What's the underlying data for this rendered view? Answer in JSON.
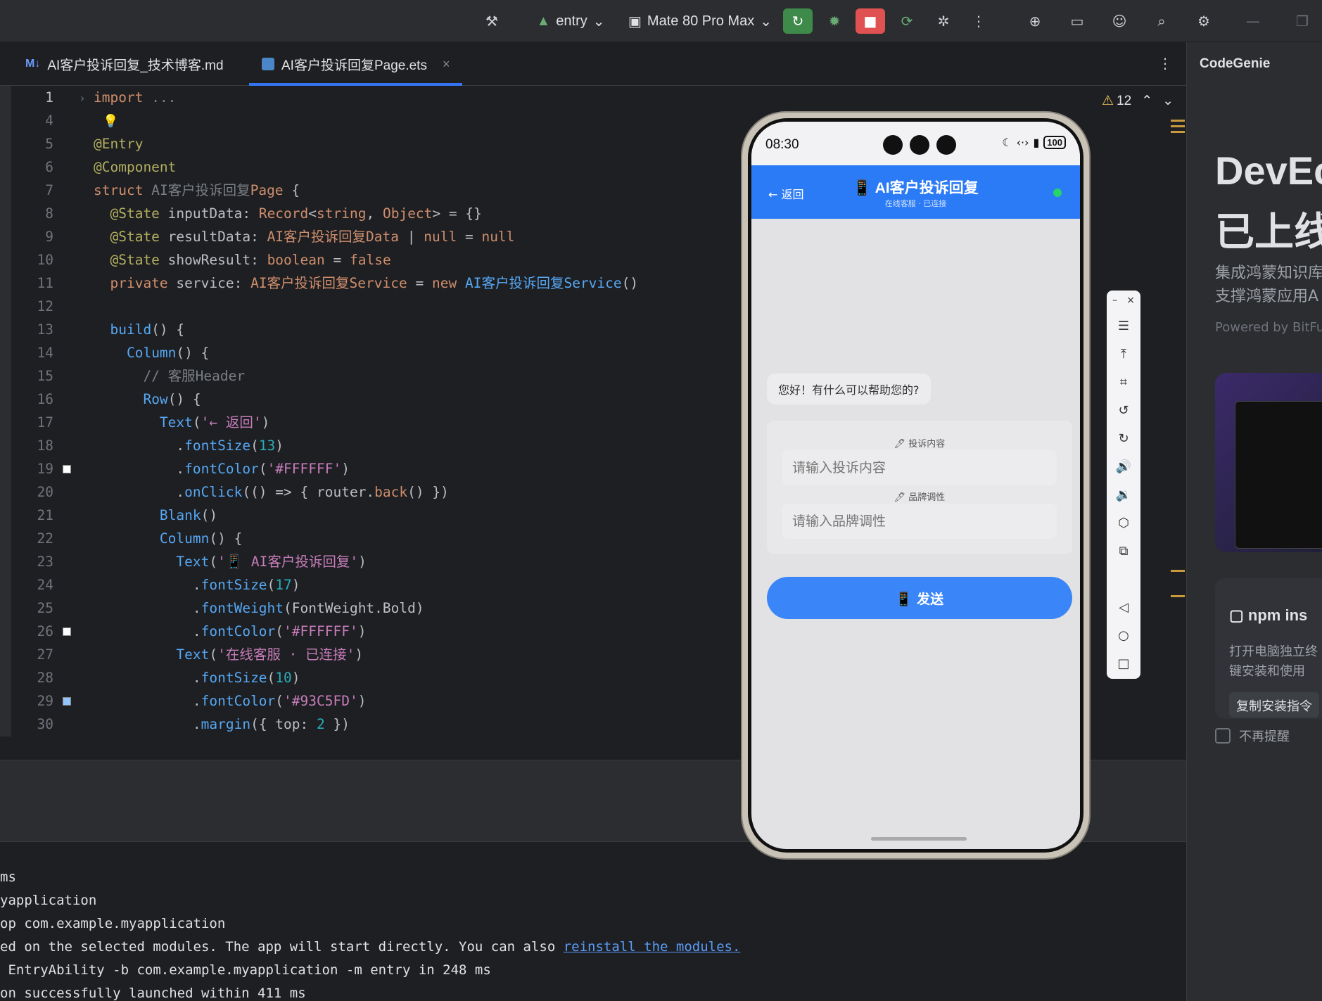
{
  "toolbar": {
    "module": "entry",
    "device": "Mate 80 Pro Max"
  },
  "tabs": [
    {
      "label": "AI客户投诉回复_技术博客.md",
      "badge": "M↓"
    },
    {
      "label": "AI客户投诉回复Page.ets",
      "close": "×"
    }
  ],
  "editor": {
    "warnings_count": "12",
    "lines": [
      {
        "n": "1",
        "html": "<span class=\"k\">import</span> <span class=\"cm\">...</span>"
      },
      {
        "n": "4",
        "html": ""
      },
      {
        "n": "5",
        "html": "<span class=\"an\">@Entry</span>"
      },
      {
        "n": "6",
        "html": "<span class=\"an\">@Component</span>"
      },
      {
        "n": "7",
        "html": "<span class=\"k\">struct</span> <span class=\"cm\">AI客户投诉回复</span><span class=\"ty\">Page</span> {"
      },
      {
        "n": "8",
        "html": "  <span class=\"an\">@State</span> inputData: <span class=\"ty\">Record</span>&lt;<span class=\"ty\">string</span>, <span class=\"ty\">Object</span>&gt; = {}"
      },
      {
        "n": "9",
        "html": "  <span class=\"an\">@State</span> resultData: <span class=\"ty\">AI客户投诉回复Data</span> | <span class=\"ty\">null</span> = <span class=\"k\">null</span>"
      },
      {
        "n": "10",
        "html": "  <span class=\"an\">@State</span> showResult: <span class=\"ty\">boolean</span> = <span class=\"k\">false</span>"
      },
      {
        "n": "11",
        "html": "  <span class=\"k\">private</span> service: <span class=\"ty\">AI客户投诉回复Service</span> = <span class=\"k\">new</span> <span class=\"fn\">AI客户投诉回复Service</span>()"
      },
      {
        "n": "12",
        "html": ""
      },
      {
        "n": "13",
        "html": "  <span class=\"fn\">build</span>() {"
      },
      {
        "n": "14",
        "html": "    <span class=\"fn\">Column</span>() {"
      },
      {
        "n": "15",
        "html": "      <span class=\"cm\">// 客服Header</span>"
      },
      {
        "n": "16",
        "html": "      <span class=\"fn\">Row</span>() {"
      },
      {
        "n": "17",
        "html": "        <span class=\"fn\">Text</span>(<span class=\"st\">'← 返回'</span>)"
      },
      {
        "n": "18",
        "html": "          .<span class=\"fn\">fontSize</span>(<span class=\"n\">13</span>)"
      },
      {
        "n": "19",
        "html": "          .<span class=\"fn\">fontColor</span>(<span class=\"st\">'#FFFFFF'</span>)",
        "sq": "#ffffff"
      },
      {
        "n": "20",
        "html": "          .<span class=\"fn\">onClick</span>(() =&gt; { router.<span class=\"ty\">back</span>() })"
      },
      {
        "n": "21",
        "html": "        <span class=\"fn\">Blank</span>()"
      },
      {
        "n": "22",
        "html": "        <span class=\"fn\">Column</span>() {"
      },
      {
        "n": "23",
        "html": "          <span class=\"fn\">Text</span>(<span class=\"st\">'📱 AI客户投诉回复'</span>)"
      },
      {
        "n": "24",
        "html": "            .<span class=\"fn\">fontSize</span>(<span class=\"n\">17</span>)"
      },
      {
        "n": "25",
        "html": "            .<span class=\"fn\">fontWeight</span>(FontWeight.Bold)"
      },
      {
        "n": "26",
        "html": "            .<span class=\"fn\">fontColor</span>(<span class=\"st\">'#FFFFFF'</span>)",
        "sq": "#ffffff"
      },
      {
        "n": "27",
        "html": "          <span class=\"fn\">Text</span>(<span class=\"st\">'在线客服 · 已连接'</span>)"
      },
      {
        "n": "28",
        "html": "            .<span class=\"fn\">fontSize</span>(<span class=\"n\">10</span>)"
      },
      {
        "n": "29",
        "html": "            .<span class=\"fn\">fontColor</span>(<span class=\"st\">'#93C5FD'</span>)",
        "sq": "#93c5fd"
      },
      {
        "n": "30",
        "html": "            .<span class=\"fn\">margin</span>({ top: <span class=\"n\">2</span> })"
      }
    ]
  },
  "console": [
    {
      "text": "ms"
    },
    {
      "text": "yapplication"
    },
    {
      "text": "op com.example.myapplication"
    },
    {
      "text": "ed on the selected modules. The app will start directly. You can also ",
      "link": "reinstall the modules."
    },
    {
      "text": " EntryAbility -b com.example.myapplication -m entry in 248 ms"
    },
    {
      "text": "on successfully launched within 411 ms"
    }
  ],
  "genie": {
    "title": "CodeGenie",
    "big1": "DevEc",
    "big2": "已上线",
    "sub1": "集成鸿蒙知识库",
    "sub2": "支撑鸿蒙应用A",
    "powered": "Powered by BitFu",
    "npm_title": "npm ins",
    "npm_desc1": "打开电脑独立终",
    "npm_desc2": "键安装和使用",
    "npm_copy": "复制安装指令",
    "no_remind": "不再提醒"
  },
  "phone": {
    "time": "08:30",
    "battery": "100",
    "back": "← 返回",
    "title": "📱 AI客户投诉回复",
    "subtitle": "在线客服 · 已连接",
    "greeting": "您好！有什么可以帮助您的?",
    "field1_label": "🖊 投诉内容",
    "field1_placeholder": "请输入投诉内容",
    "field2_label": "🖊 品牌调性",
    "field2_placeholder": "请输入品牌调性",
    "send": "📱 发送"
  },
  "colors": {
    "header_blue": "#2b7bf6",
    "send_blue": "#3a86f8",
    "online_green": "#27d36b"
  }
}
